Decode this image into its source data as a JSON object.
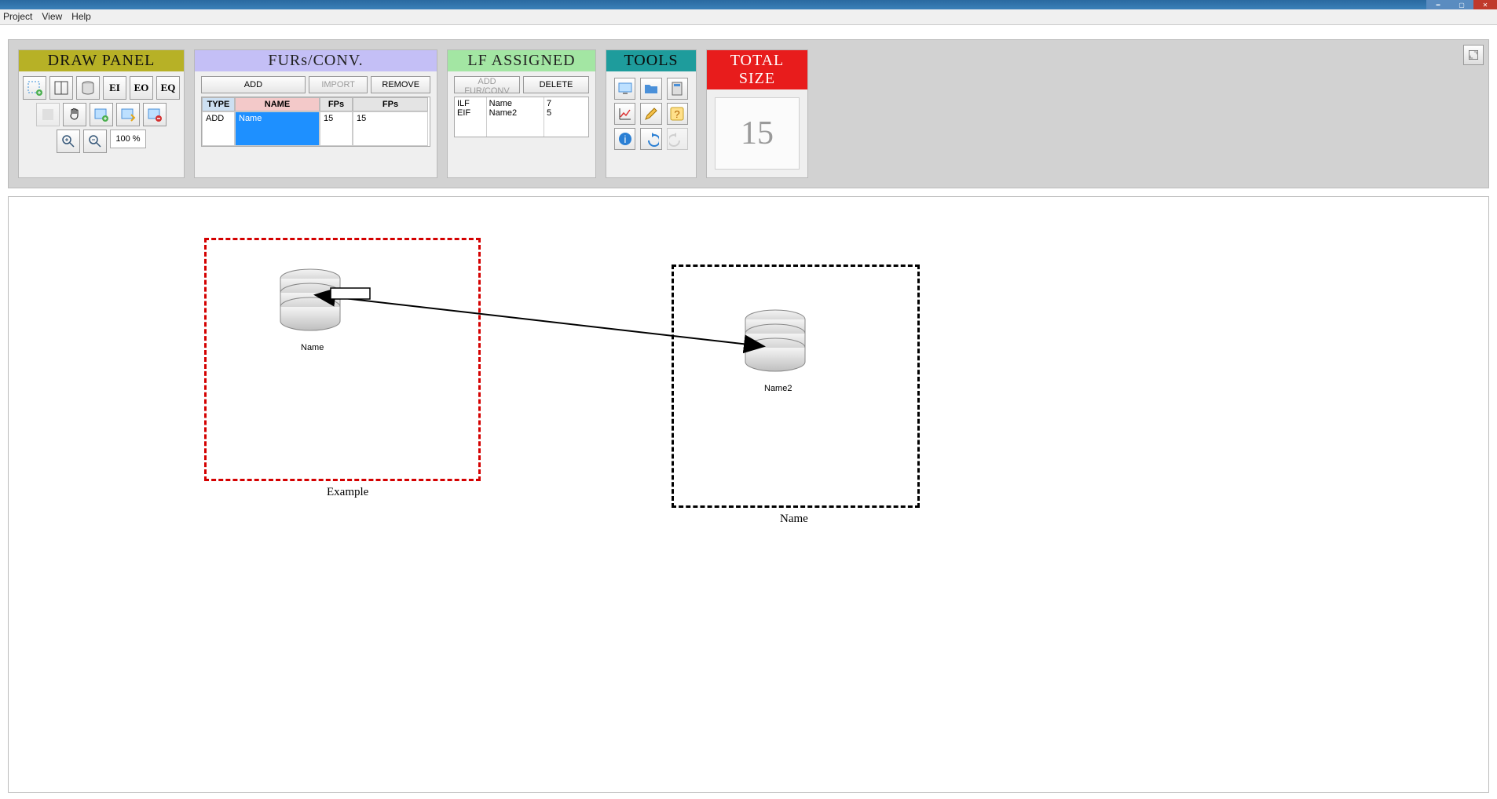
{
  "menubar": {
    "items": [
      "Project",
      "View",
      "Help"
    ]
  },
  "zoom": {
    "pct_label": "100 %"
  },
  "panels": {
    "draw": "DRAW PANEL",
    "furs": "FURs/CONV.",
    "lf": "LF ASSIGNED",
    "tools": "TOOLS",
    "total": "TOTAL SIZE"
  },
  "draw_labels": {
    "ei": "EI",
    "eo": "EO",
    "eq": "EQ"
  },
  "furs": {
    "btn_add": "ADD",
    "btn_import": "IMPORT",
    "btn_remove": "REMOVE",
    "headers": {
      "type": "TYPE",
      "name": "NAME",
      "fps1": "FPs",
      "fps2": "FPs"
    },
    "row": {
      "type": "ADD",
      "name": "Name",
      "fp1": "15",
      "fp2": "15"
    }
  },
  "lf": {
    "btn_add": "ADD FUR/CONV",
    "btn_delete": "DELETE",
    "rows": [
      {
        "type": "ILF",
        "name": "Name",
        "val": "7"
      },
      {
        "type": "EIF",
        "name": "Name2",
        "val": "5"
      }
    ]
  },
  "total_size": "15",
  "canvas": {
    "box1_caption": "Example",
    "box2_caption": "Name",
    "db1_label": "Name",
    "db2_label": "Name2"
  }
}
